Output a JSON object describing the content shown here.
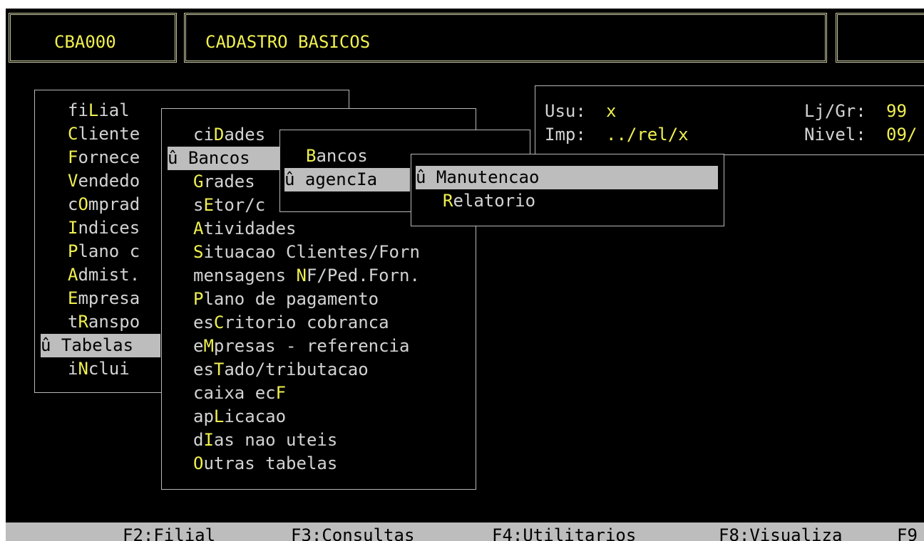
{
  "header": {
    "program_code": "CBA000",
    "title": "CADASTRO BASICOS"
  },
  "info": {
    "usu_label": "Usu:",
    "usu_value": "x",
    "imp_label": "Imp:",
    "imp_value": "../rel/x",
    "ljgr_label": "Lj/Gr:",
    "ljgr_value": "99",
    "nivel_label": "Nivel:",
    "nivel_value": "09/"
  },
  "main_menu": {
    "items": [
      {
        "pre": "fi",
        "key": "L",
        "post": "ial"
      },
      {
        "pre": "",
        "key": "C",
        "post": "liente"
      },
      {
        "pre": "",
        "key": "F",
        "post": "ornece"
      },
      {
        "pre": "",
        "key": "V",
        "post": "endedo"
      },
      {
        "pre": "c",
        "key": "O",
        "post": "mprad"
      },
      {
        "pre": "",
        "key": "I",
        "post": "ndices"
      },
      {
        "pre": "",
        "key": "P",
        "post": "lano c"
      },
      {
        "pre": "",
        "key": "A",
        "post": "dmist."
      },
      {
        "pre": "",
        "key": "E",
        "post": "mpresa"
      },
      {
        "pre": "t",
        "key": "R",
        "post": "anspo"
      },
      {
        "pre": "û ",
        "key": "T",
        "post": "abelas"
      },
      {
        "pre": "i",
        "key": "N",
        "post": "clui"
      }
    ],
    "selected": 10
  },
  "tables_menu": {
    "items": [
      {
        "pre": "ci",
        "key": "D",
        "post": "ades"
      },
      {
        "pre": "û ",
        "key": "B",
        "post": "ancos"
      },
      {
        "pre": "",
        "key": "G",
        "post": "rades"
      },
      {
        "pre": "s",
        "key": "E",
        "post": "tor/c"
      },
      {
        "pre": "",
        "key": "A",
        "post": "tividades"
      },
      {
        "pre": "",
        "key": "S",
        "post": "ituacao Clientes/Forn"
      },
      {
        "pre": "mensagens ",
        "key": "N",
        "post": "F/Ped.Forn."
      },
      {
        "pre": "",
        "key": "P",
        "post": "lano de pagamento"
      },
      {
        "pre": "es",
        "key": "C",
        "post": "ritorio cobranca"
      },
      {
        "pre": "e",
        "key": "M",
        "post": "presas - referencia"
      },
      {
        "pre": "es",
        "key": "T",
        "post": "ado/tributacao"
      },
      {
        "pre": "caixa ec",
        "key": "F",
        "post": ""
      },
      {
        "pre": "ap",
        "key": "L",
        "post": "icacao"
      },
      {
        "pre": "d",
        "key": "I",
        "post": "as nao uteis"
      },
      {
        "pre": "",
        "key": "O",
        "post": "utras tabelas"
      }
    ],
    "selected": 1
  },
  "bancos_menu": {
    "items": [
      {
        "pre": "",
        "key": "B",
        "post": "ancos"
      },
      {
        "pre": "û agenc",
        "key": "I",
        "post": "a"
      }
    ],
    "selected": 1
  },
  "agencia_menu": {
    "items": [
      {
        "pre": "û ",
        "key": "M",
        "post": "anutencao"
      },
      {
        "pre": "",
        "key": "R",
        "post": "elatorio"
      }
    ],
    "selected": 0
  },
  "function_keys": [
    "F2:Filial",
    "F3:Consultas",
    "F4:Utilitarios",
    "F8:Visualiza",
    "F9"
  ]
}
